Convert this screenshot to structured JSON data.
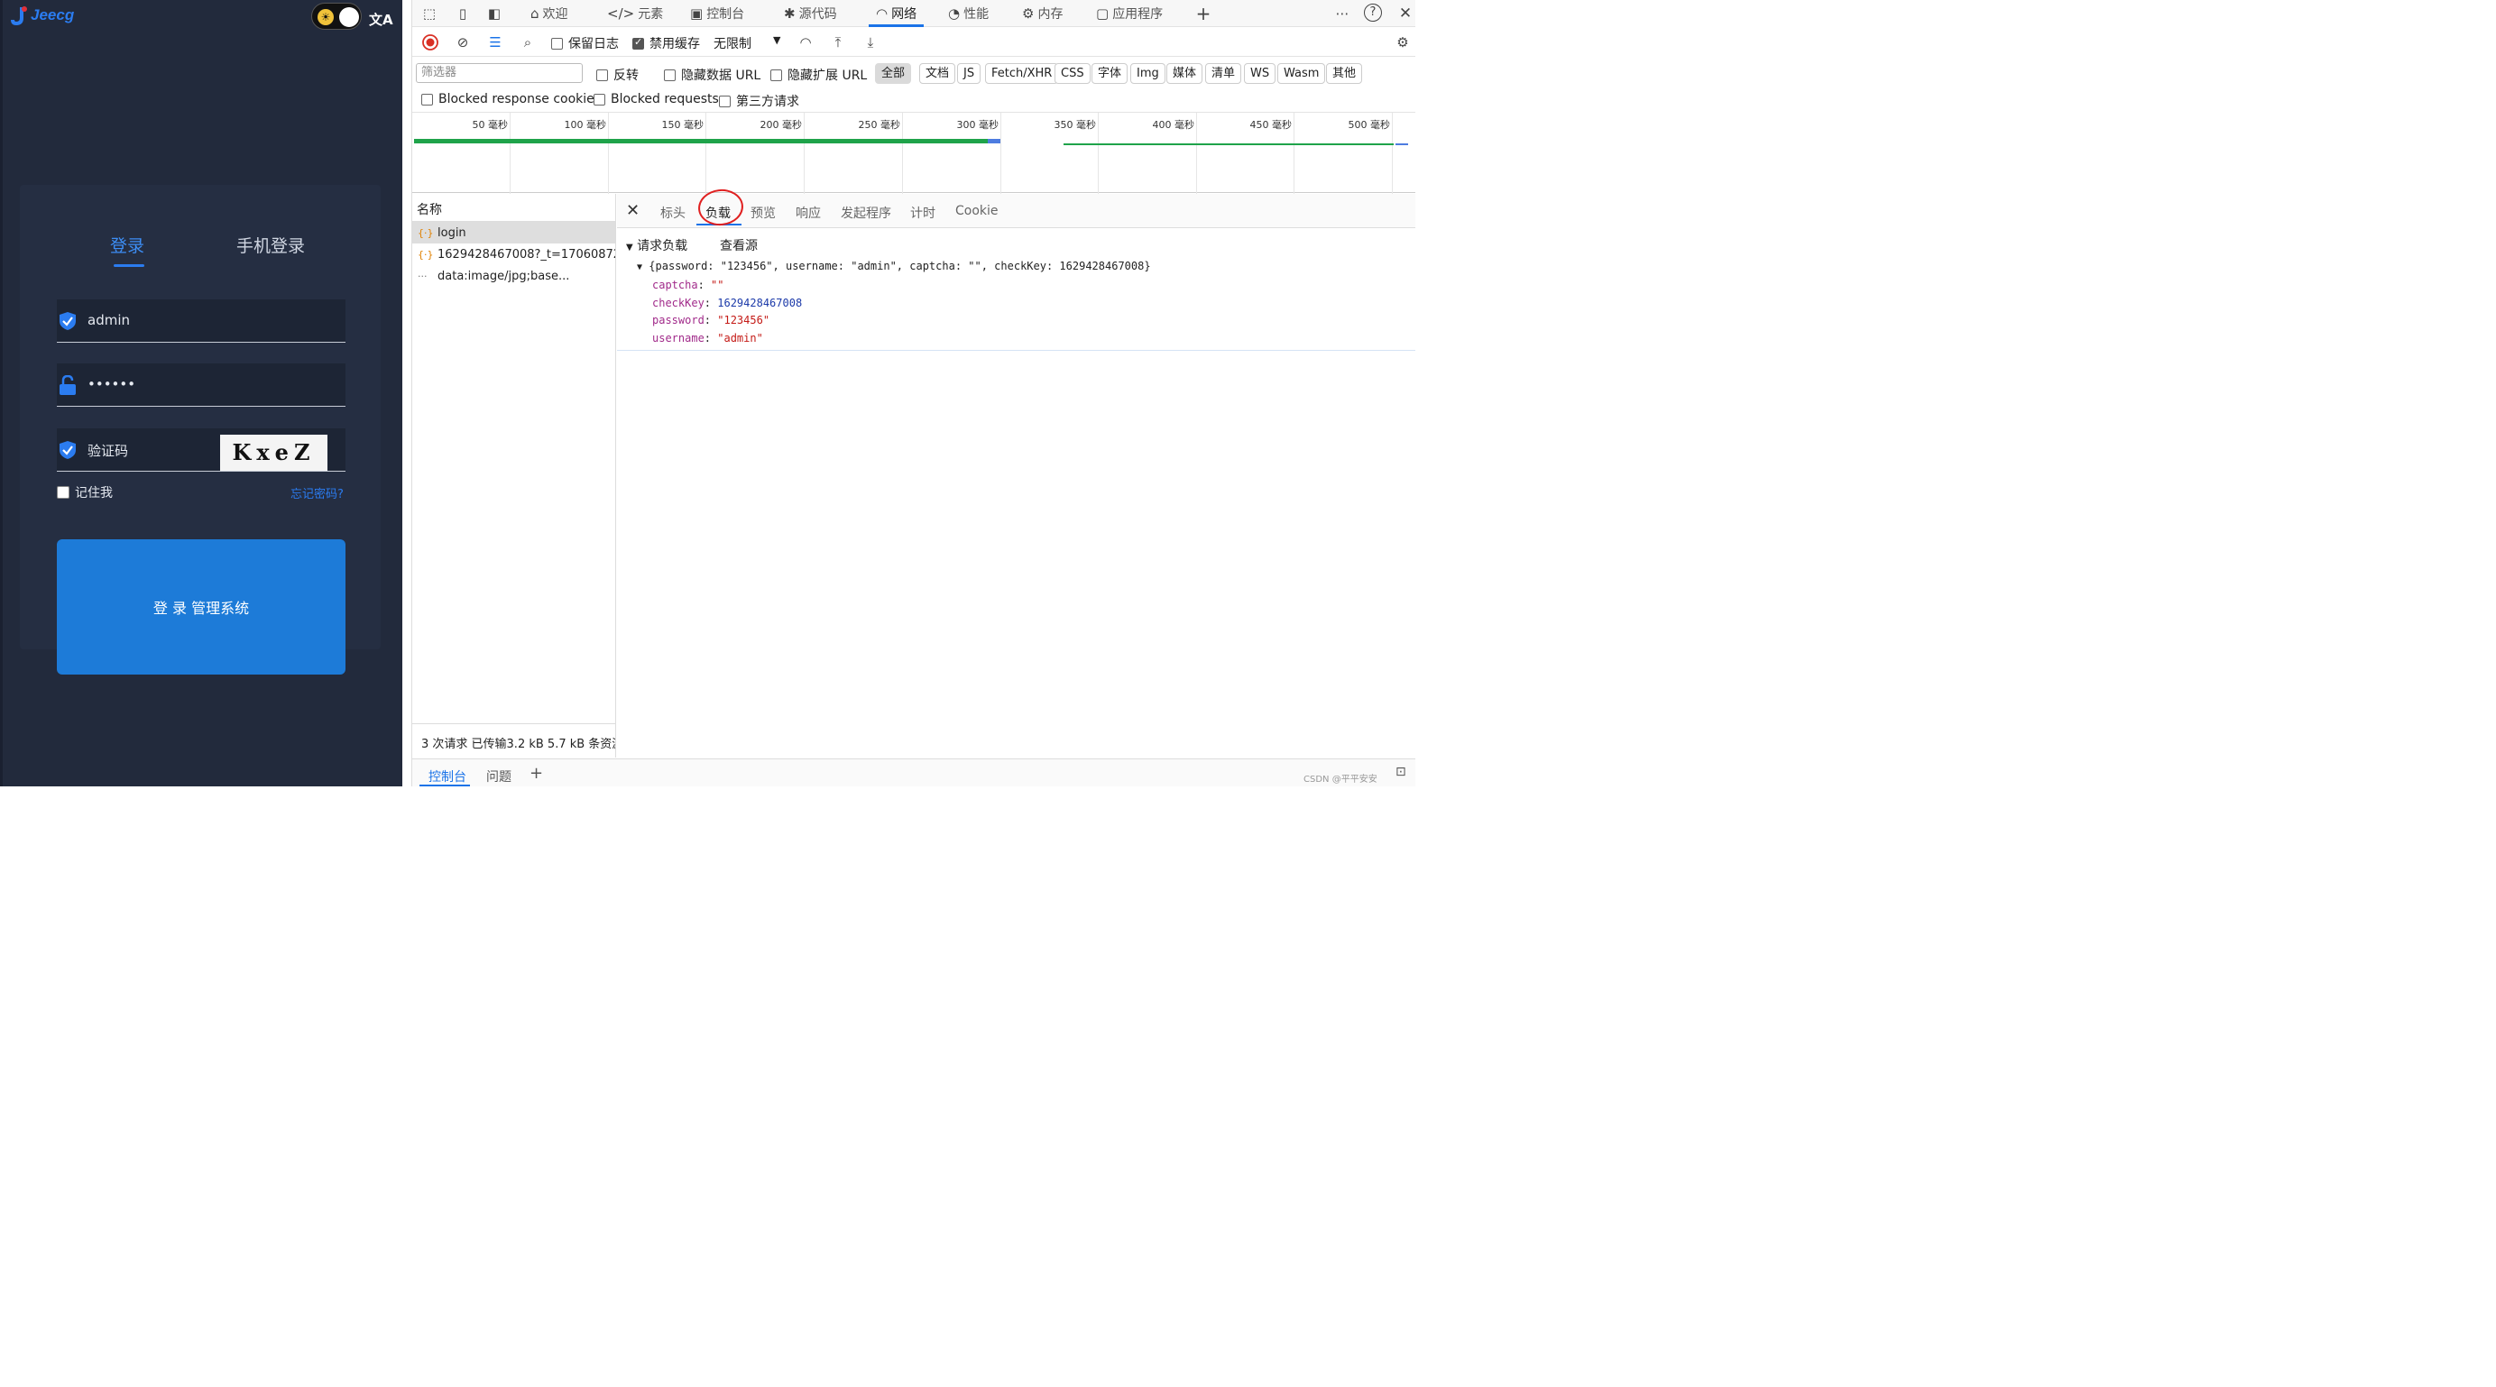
{
  "app": {
    "logo_text": "Jeecg",
    "lang_icon": "文A",
    "tabs": {
      "login": "登录",
      "phone_login": "手机登录"
    },
    "username_value": "admin",
    "password_value": "••••••",
    "captcha_placeholder": "验证码",
    "captcha_image_text": "KxeZ",
    "remember_me": "记住我",
    "forgot_password": "忘记密码?",
    "login_button": "登 录 管理系统",
    "accent_color": "#2b7cf0"
  },
  "devtools": {
    "main_tabs": [
      {
        "label": "欢迎",
        "icon": "home-icon"
      },
      {
        "label": "元素",
        "icon": "code-icon"
      },
      {
        "label": "控制台",
        "icon": "console-icon"
      },
      {
        "label": "源代码",
        "icon": "bug-icon"
      },
      {
        "label": "网络",
        "icon": "wifi-icon"
      },
      {
        "label": "性能",
        "icon": "gauge-icon"
      },
      {
        "label": "内存",
        "icon": "chip-icon"
      },
      {
        "label": "应用程序",
        "icon": "app-icon"
      }
    ],
    "active_main_tab": "网络",
    "toolbar": {
      "preserve_log": "保留日志",
      "disable_cache": "禁用缓存",
      "throttling": "无限制"
    },
    "filter": {
      "placeholder": "筛选器",
      "invert": "反转",
      "hide_data_urls": "隐藏数据 URL",
      "hide_extension_urls": "隐藏扩展 URL",
      "types": [
        "全部",
        "文档",
        "JS",
        "Fetch/XHR",
        "CSS",
        "字体",
        "Img",
        "媒体",
        "清单",
        "WS",
        "Wasm",
        "其他"
      ],
      "active_type": "全部",
      "blocked_response_cookies": "Blocked response cookies",
      "blocked_requests": "Blocked requests",
      "third_party": "第三方请求"
    },
    "timeline_labels": [
      "50 毫秒",
      "100 毫秒",
      "150 毫秒",
      "200 毫秒",
      "250 毫秒",
      "300 毫秒",
      "350 毫秒",
      "400 毫秒",
      "450 毫秒",
      "500 毫秒"
    ],
    "request_list": {
      "header": "名称",
      "rows": [
        {
          "name": "login",
          "icon": "xhr-icon"
        },
        {
          "name": "1629428467008?_t=17060872...",
          "icon": "xhr-icon"
        },
        {
          "name": "data:image/jpg;base...",
          "icon": "data-icon"
        }
      ]
    },
    "summary": "3 次请求   已传输3.2 kB   5.7 kB 条资源",
    "detail_tabs": [
      "标头",
      "负载",
      "预览",
      "响应",
      "发起程序",
      "计时",
      "Cookie"
    ],
    "active_detail_tab": "负载",
    "payload": {
      "section_title": "请求负载",
      "view_source": "查看源",
      "object_summary": "{password: \"123456\", username: \"admin\", captcha: \"\", checkKey: 1629428467008}",
      "fields": [
        {
          "key": "captcha",
          "value": "\"\"",
          "kind": "str"
        },
        {
          "key": "checkKey",
          "value": "1629428467008",
          "kind": "num"
        },
        {
          "key": "password",
          "value": "\"123456\"",
          "kind": "str"
        },
        {
          "key": "username",
          "value": "\"admin\"",
          "kind": "str"
        }
      ]
    },
    "drawer_tabs": [
      "控制台",
      "问题"
    ],
    "watermark": "CSDN @平平安安"
  }
}
